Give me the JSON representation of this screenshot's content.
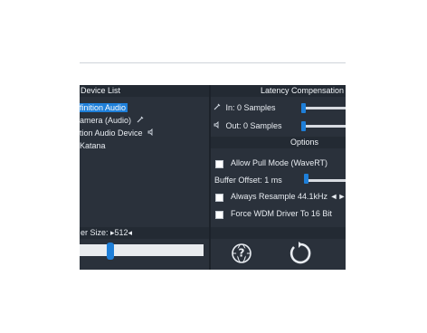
{
  "device_list": {
    "header": "Device List",
    "items": [
      {
        "label": "finition Audio",
        "selected": true,
        "icon": ""
      },
      {
        "label": "amera (Audio)",
        "selected": false,
        "icon": "microphone-icon"
      },
      {
        "label": "tion Audio Device",
        "selected": false,
        "icon": "speaker-icon"
      },
      {
        "label": "Katana",
        "selected": false,
        "icon": ""
      }
    ]
  },
  "latency": {
    "header": "Latency Compensation",
    "in_label": "In: 0 Samples",
    "out_label": "Out: 0 Samples",
    "in_value": 0,
    "out_value": 0
  },
  "options": {
    "header": "Options",
    "allow_pull_mode": {
      "label": "Allow Pull Mode (WaveRT)",
      "checked": false
    },
    "buffer_offset": {
      "label": "Buffer Offset: 1 ms",
      "value_ms": 1
    },
    "always_resample": {
      "label": "Always Resample 44.1kHz ◄►",
      "checked": false
    },
    "force_wdm": {
      "label": "Force WDM Driver To 16 Bit",
      "checked": false
    }
  },
  "buffer": {
    "label": "er Size: ▸512◂"
  },
  "colors": {
    "panel_bg": "#2a313b",
    "header_bg": "#232a33",
    "accent": "#1e7fd9",
    "text": "#e8ecf1"
  },
  "icons": {
    "help": "help-globe-icon",
    "reset": "reset-icon"
  }
}
